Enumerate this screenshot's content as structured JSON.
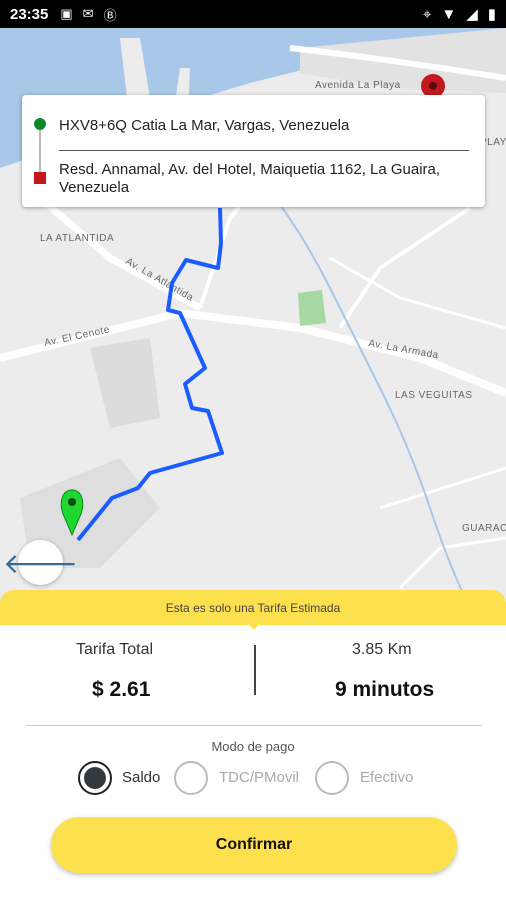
{
  "status_bar": {
    "time": "23:35",
    "icons": [
      "image-icon",
      "mail-icon",
      "b-icon"
    ],
    "right_icons": [
      "location-icon",
      "wifi-icon",
      "signal-icon",
      "battery-icon"
    ]
  },
  "map": {
    "labels": {
      "avenida_la_playa": "Avenida La Playa",
      "la_atlantida": "LA ATLANTIDA",
      "av_la_atlantida": "Av. La Atlantida",
      "av_el_cenote": "Av. El Cenote",
      "av_la_armada": "Av. La Armada",
      "las_veguitas": "LAS VEGUITAS",
      "guaraca": "GUARACA",
      "playa": "PLAYA"
    }
  },
  "route": {
    "origin": "HXV8+6Q Catia La Mar, Vargas, Venezuela",
    "destination": "Resd. Annamal, Av. del Hotel, Maiquetia 1162, La Guaira, Venezuela"
  },
  "fare": {
    "notice": "Esta es solo una Tarifa Estimada",
    "total_label": "Tarifa Total",
    "total_value": "$ 2.61",
    "distance": "3.85 Km",
    "duration": "9 minutos"
  },
  "payment": {
    "title": "Modo de pago",
    "options": [
      "Saldo",
      "TDC/PMovil",
      "Efectivo"
    ],
    "selected": "Saldo"
  },
  "confirm_label": "Confirmar",
  "colors": {
    "accent": "#fce04e",
    "route": "#1a5cff",
    "origin_marker": "#0d8a2a",
    "destination_marker": "#c2181e"
  }
}
